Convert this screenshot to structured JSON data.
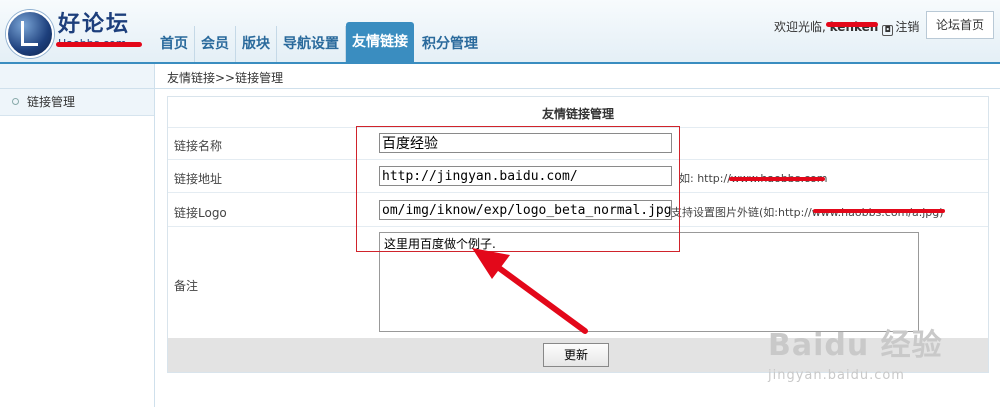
{
  "header": {
    "logo_title": "好论坛",
    "logo_subtitle": "Haobbs.com",
    "nav": [
      "首页",
      "会员",
      "版块",
      "导航设置",
      "友情链接",
      "积分管理"
    ],
    "active_nav": "友情链接",
    "welcome_text": "欢迎光临, ",
    "username": "kenken",
    "logout_label": "注销",
    "home_button": "论坛首页"
  },
  "breadcrumb": "友情链接>>链接管理",
  "sidebar": {
    "items": [
      {
        "label": "链接管理"
      }
    ]
  },
  "form": {
    "title": "友情链接管理",
    "fields": [
      {
        "label": "链接名称",
        "value": "百度经验"
      },
      {
        "label": "链接地址",
        "value": "http://jingyan.baidu.com/",
        "hint": "如: http://www.haobbs.com"
      },
      {
        "label": "链接Logo",
        "value": "om/img/iknow/exp/logo_beta_normal.jpg",
        "hint": "支持设置图片外链(如:http://www.haobbs.com/a.jpg)"
      }
    ],
    "remark_label": "备注",
    "remark_value": "这里用百度做个例子.",
    "submit_label": "更新"
  },
  "annotation": {
    "color": "#e3081a"
  },
  "watermark": {
    "main": "Baidu 经验",
    "sub": "jingyan.baidu.com"
  }
}
